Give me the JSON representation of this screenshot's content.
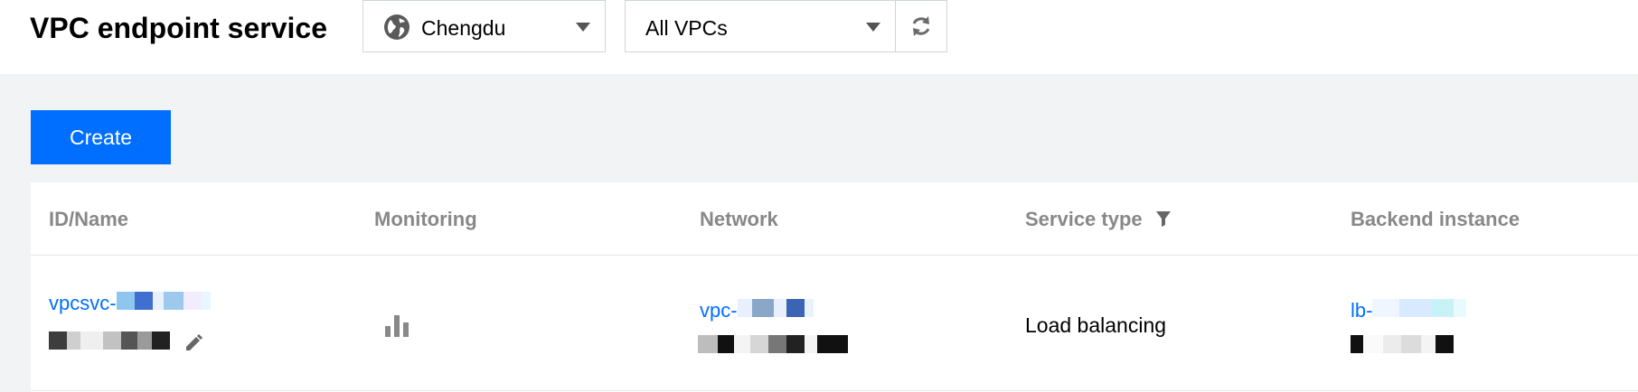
{
  "header": {
    "title": "VPC endpoint service",
    "region_select": {
      "value": "Chengdu",
      "icon": "globe-icon"
    },
    "vpc_select": {
      "value": "All VPCs"
    },
    "refresh_icon": "refresh-icon"
  },
  "toolbar": {
    "create_label": "Create"
  },
  "table": {
    "columns": [
      {
        "label": "ID/Name"
      },
      {
        "label": "Monitoring"
      },
      {
        "label": "Network"
      },
      {
        "label": "Service type",
        "icon": "filter-icon"
      },
      {
        "label": "Backend instance"
      }
    ],
    "rows": [
      {
        "id_prefix": "vpcsvc-",
        "monitoring_icon": "bar-chart-icon",
        "network_prefix": "vpc-",
        "service_type": "Load balancing",
        "backend_prefix": "lb-",
        "edit_icon": "pencil-icon"
      }
    ]
  },
  "colors": {
    "primary": "#006eff",
    "header_text": "#888888",
    "page_bg": "#f2f3f5",
    "border": "#cfd5de"
  }
}
